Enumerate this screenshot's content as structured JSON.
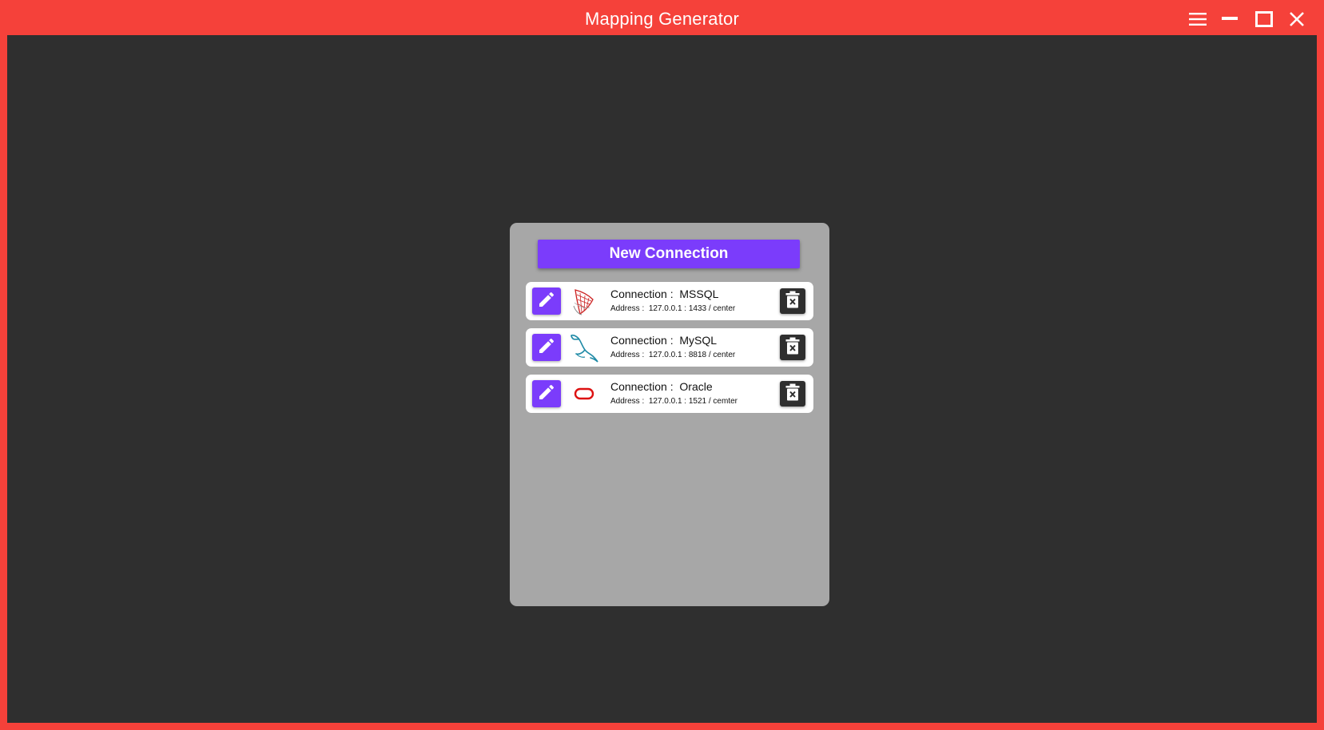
{
  "window": {
    "title": "Mapping Generator",
    "accent_color": "#f5413a",
    "background_color": "#2f2f2f",
    "controls": [
      "menu-icon",
      "minimize-icon",
      "maximize-icon",
      "close-icon"
    ]
  },
  "panel": {
    "background_color": "#a7a7a7",
    "new_connection_label": "New Connection",
    "button_color": "#7b3cfb"
  },
  "connections": [
    {
      "name_label": "Connection :",
      "name": "MSSQL",
      "address_label": "Address :",
      "address": "127.0.0.1 : 1433 / center",
      "logo": "mssql-logo-icon"
    },
    {
      "name_label": "Connection :",
      "name": "MySQL",
      "address_label": "Address :",
      "address": "127.0.0.1 : 8818 / center",
      "logo": "mysql-dolphin-icon"
    },
    {
      "name_label": "Connection :",
      "name": "Oracle",
      "address_label": "Address :",
      "address": "127.0.0.1 : 1521 / cemter",
      "logo": "oracle-logo-icon"
    }
  ]
}
